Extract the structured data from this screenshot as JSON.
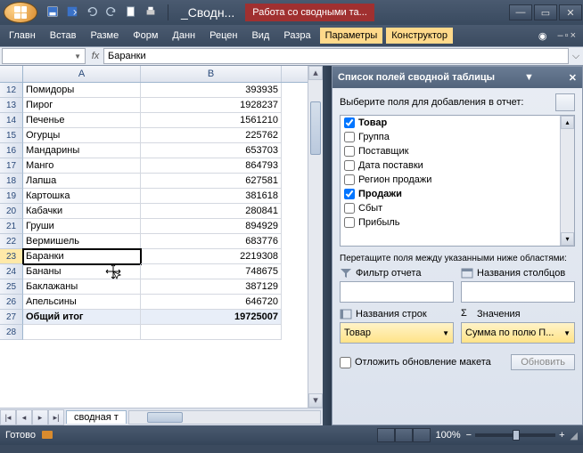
{
  "title": "_Сводн...",
  "context_tab": "Работа со сводными та...",
  "tabs": [
    "Главн",
    "Встав",
    "Разме",
    "Форм",
    "Данн",
    "Рецен",
    "Вид",
    "Разра"
  ],
  "ctabs": [
    "Параметры",
    "Конструктор"
  ],
  "namebox": "",
  "fx_value": "Баранки",
  "cols": [
    "A",
    "B"
  ],
  "rows": [
    {
      "n": 12,
      "a": "Помидоры",
      "b": "393935"
    },
    {
      "n": 13,
      "a": "Пирог",
      "b": "1928237"
    },
    {
      "n": 14,
      "a": "Печенье",
      "b": "1561210"
    },
    {
      "n": 15,
      "a": "Огурцы",
      "b": "225762"
    },
    {
      "n": 16,
      "a": "Мандарины",
      "b": "653703"
    },
    {
      "n": 17,
      "a": "Манго",
      "b": "864793"
    },
    {
      "n": 18,
      "a": "Лапша",
      "b": "627581"
    },
    {
      "n": 19,
      "a": "Картошка",
      "b": "381618"
    },
    {
      "n": 20,
      "a": "Кабачки",
      "b": "280841"
    },
    {
      "n": 21,
      "a": "Груши",
      "b": "894929"
    },
    {
      "n": 22,
      "a": "Вермишель",
      "b": "683776"
    },
    {
      "n": 23,
      "a": "Баранки",
      "b": "2219308",
      "sel": true
    },
    {
      "n": 24,
      "a": "Бананы",
      "b": "748675"
    },
    {
      "n": 25,
      "a": "Баклажаны",
      "b": "387129"
    },
    {
      "n": 26,
      "a": "Апельсины",
      "b": "646720"
    },
    {
      "n": 27,
      "a": "Общий итог",
      "b": "19725007",
      "total": true
    },
    {
      "n": 28,
      "a": "",
      "b": ""
    }
  ],
  "sheet_tab": "сводная т",
  "pane": {
    "title": "Список полей сводной таблицы",
    "subtitle": "Выберите поля для добавления в отчет:",
    "fields": [
      {
        "label": "Товар",
        "checked": true,
        "bold": true
      },
      {
        "label": "Группа",
        "checked": false
      },
      {
        "label": "Поставщик",
        "checked": false
      },
      {
        "label": "Дата поставки",
        "checked": false
      },
      {
        "label": "Регион продажи",
        "checked": false
      },
      {
        "label": "Продажи",
        "checked": true,
        "bold": true
      },
      {
        "label": "Сбыт",
        "checked": false
      },
      {
        "label": "Прибыль",
        "checked": false
      }
    ],
    "drag": "Перетащите поля между указанными ниже областями:",
    "z_filter": "Фильтр отчета",
    "z_cols": "Названия столбцов",
    "z_rows": "Названия строк",
    "z_vals": "Значения",
    "row_val": "Товар",
    "val_val": "Сумма по полю П...",
    "defer": "Отложить обновление макета",
    "update": "Обновить"
  },
  "status": {
    "ready": "Готово",
    "zoom": "100%"
  }
}
